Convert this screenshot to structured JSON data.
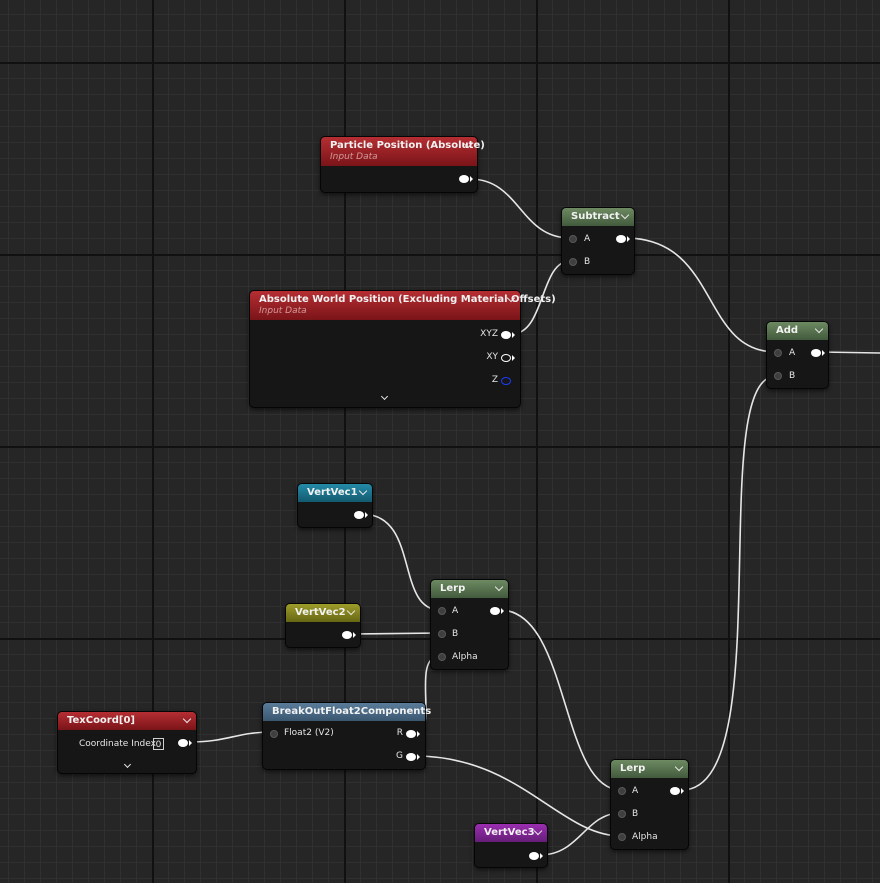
{
  "nodes": {
    "particle_position": {
      "title": "Particle Position (Absolute)",
      "subtitle": "Input Data",
      "header_color": "#a1232a"
    },
    "absolute_world_position": {
      "title": "Absolute World Position (Excluding Material Offsets)",
      "subtitle": "Input Data",
      "outputs": [
        "XYZ",
        "XY",
        "Z"
      ],
      "header_color": "#a1232a"
    },
    "subtract": {
      "title": "Subtract",
      "inputs": [
        "A",
        "B"
      ],
      "header_color": "#5a7650"
    },
    "add": {
      "title": "Add",
      "inputs": [
        "A",
        "B"
      ],
      "header_color": "#5a7650"
    },
    "vertvec1": {
      "title": "VertVec1",
      "header_color": "#1f7d98"
    },
    "vertvec2": {
      "title": "VertVec2",
      "header_color": "#8c8b20"
    },
    "vertvec3": {
      "title": "VertVec3",
      "header_color": "#8a27a0"
    },
    "lerp_top": {
      "title": "Lerp",
      "inputs": [
        "A",
        "B",
        "Alpha"
      ],
      "header_color": "#5a7650"
    },
    "lerp_bottom": {
      "title": "Lerp",
      "inputs": [
        "A",
        "B",
        "Alpha"
      ],
      "header_color": "#5a7650"
    },
    "texcoord": {
      "title": "TexCoord[0]",
      "param_label": "Coordinate Index",
      "param_value": "0",
      "header_color": "#a1232a"
    },
    "breakout": {
      "title": "BreakOutFloat2Components",
      "input": "Float2 (V2)",
      "outputs": [
        "R",
        "G"
      ],
      "header_color": "#4d6c88"
    }
  },
  "wire_color": "#ffffff",
  "icons": {
    "collapse": "chevron-down-icon",
    "advanced": "chevron-down-icon"
  }
}
